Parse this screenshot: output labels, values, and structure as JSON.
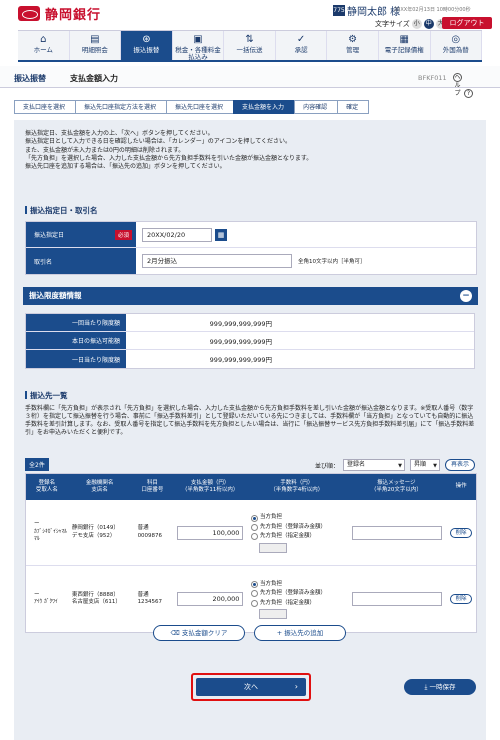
{
  "header": {
    "bank_name": "静岡銀行",
    "user_icon": "775",
    "user_name": "静岡太郎 様",
    "datetime": "20XX年02月13日 10時00分00秒",
    "font_size_label": "文字サイズ",
    "font_sizes": [
      "小",
      "中",
      "大"
    ],
    "logout": "ログアウト"
  },
  "nav": [
    {
      "icon": "home-icon",
      "label": "ホーム"
    },
    {
      "icon": "doc-icon",
      "label": "明細照会"
    },
    {
      "icon": "transfer-icon",
      "label": "振込振替"
    },
    {
      "icon": "tax-icon",
      "label": "税金・各種料金払込み"
    },
    {
      "icon": "bulk-icon",
      "label": "一括伝送"
    },
    {
      "icon": "approve-icon",
      "label": "承認"
    },
    {
      "icon": "manage-icon",
      "label": "管理"
    },
    {
      "icon": "record-icon",
      "label": "電子記録債権"
    },
    {
      "icon": "fx-icon",
      "label": "外国為替"
    }
  ],
  "title": {
    "category": "振込振替",
    "page": "支払金額入力",
    "code": "BFKF011",
    "help": "ヘルプ"
  },
  "steps": [
    "支払口座を選択",
    "振込先口座指定方法を選択",
    "振込先口座を選択",
    "支払金額を入力",
    "内容確認",
    "確定"
  ],
  "intro": [
    "振込指定日、支払金額を入力の上、「次へ」ボタンを押してください。",
    "振込指定日として入力できる日を確認したい場合は、「カレンダー」のアイコンを押してください。",
    "また、支払金額が未入力または0円の明細は削除されます。",
    "「先方負担」を選択した場合、入力した支払金額から先方負担手数料を引いた金額が振込金額となります。",
    "振込先口座を追加する場合は、「振込先の追加」ボタンを押してください。"
  ],
  "date_section": {
    "heading": "振込指定日・取引名",
    "date_label": "振込指定日",
    "required": "必須",
    "date_value": "20XX/02/20",
    "name_label": "取引名",
    "name_value": "2月分振込",
    "name_hint": "全角10文字以内［半角可］"
  },
  "limit_section": {
    "heading": "振込限度額情報",
    "rows": [
      {
        "label": "一回当たり限度額",
        "value": "999,999,999,999円"
      },
      {
        "label": "本日の振込可能額",
        "value": "999,999,999,999円"
      },
      {
        "label": "一日当たり限度額",
        "value": "999,999,999,999円"
      }
    ]
  },
  "payee_section": {
    "heading": "振込先一覧",
    "note": "手数料欄に「先方負担」が表示され「先方負担」を選択した場合、入力した支払金額から先方負担手数料を差し引いた金額が振込金額となります。※受取人番号（数字３桁）を指定して振込振替を行う場合、事前に「振込手数料差引」として登録いただいている先につきましては、手数料欄が「当方負担」となっていても自動的に振込手数料を差引計算します。なお、受取人番号を指定して振込手数料を先方負担としたい場合は、当行に「振込振替サービス先方負担手数料差引届」にて「振込手数料差引」をお申込みいただくと便利です。",
    "count": "全2件",
    "sort_label": "並び順：",
    "sort_field": "登録名",
    "sort_order": "昇順",
    "redisplay": "再表示",
    "columns": [
      "登録名\n受取人名",
      "金融機関名\n支店名",
      "科目\n口座番号",
      "支払金額（円）\n（半角数字11桁以内）",
      "手数料（円）\n（半角数字4桁以内）",
      "振込メッセージ\n（半角20文字以内）",
      "操作"
    ],
    "rows": [
      {
        "reg": "ー",
        "payee": "ｶﾌﾞｼｷｶﾞｲｼｬﾏﾙﾏﾙ",
        "bank": "静岡銀行（0149）",
        "branch": "デモ支店（952）",
        "type": "普通",
        "acct": "0009876",
        "amount": "100,000",
        "fee_opts": [
          "当方負担",
          "先方負担（登録済み金額）",
          "先方負担（指定金額）"
        ],
        "delete": "削除"
      },
      {
        "reg": "ー",
        "payee": "ｱｲｳ ｶﾞｸﾜｲ",
        "bank": "東西銀行（8888）",
        "branch": "名古屋支店（611）",
        "type": "普通",
        "acct": "1234567",
        "amount": "200,000",
        "fee_opts": [
          "当方負担",
          "先方負担（登録済み金額）",
          "先方負担（指定金額）"
        ],
        "delete": "削除"
      }
    ]
  },
  "actions": {
    "clear": "支払金額クリア",
    "add": "振込先の追加",
    "next": "次へ",
    "save": "一時保存"
  }
}
